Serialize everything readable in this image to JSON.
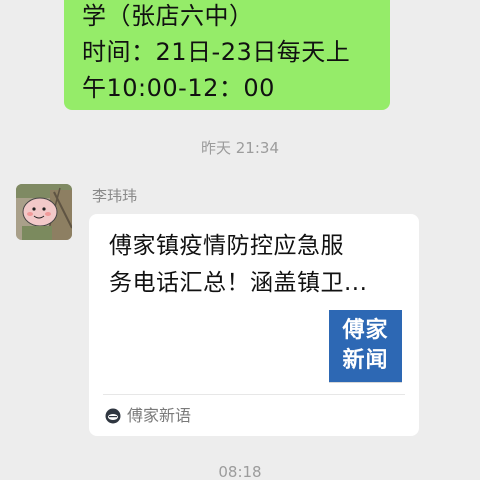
{
  "outgoing_message": {
    "lines": [
      "学（张店六中）",
      "时间：21日-23日每天上",
      "午10:00-12：00"
    ]
  },
  "timestamps": [
    "昨天 21:34",
    "08:18"
  ],
  "incoming_message": {
    "sender": "李玮玮",
    "avatar_icon": "cartoon-avatar-icon",
    "card": {
      "title_lines": [
        "傅家镇疫情防控应急服",
        "务电话汇总！涵盖镇卫..."
      ],
      "thumbnail_lines": [
        "傅家",
        "新闻"
      ],
      "source_icon": "official-account-icon",
      "source_name": "傅家新语"
    }
  },
  "colors": {
    "background": "#ededed",
    "outgoing_bubble": "#95ec69",
    "incoming_bubble": "#ffffff",
    "thumbnail": "#2d68b4"
  }
}
